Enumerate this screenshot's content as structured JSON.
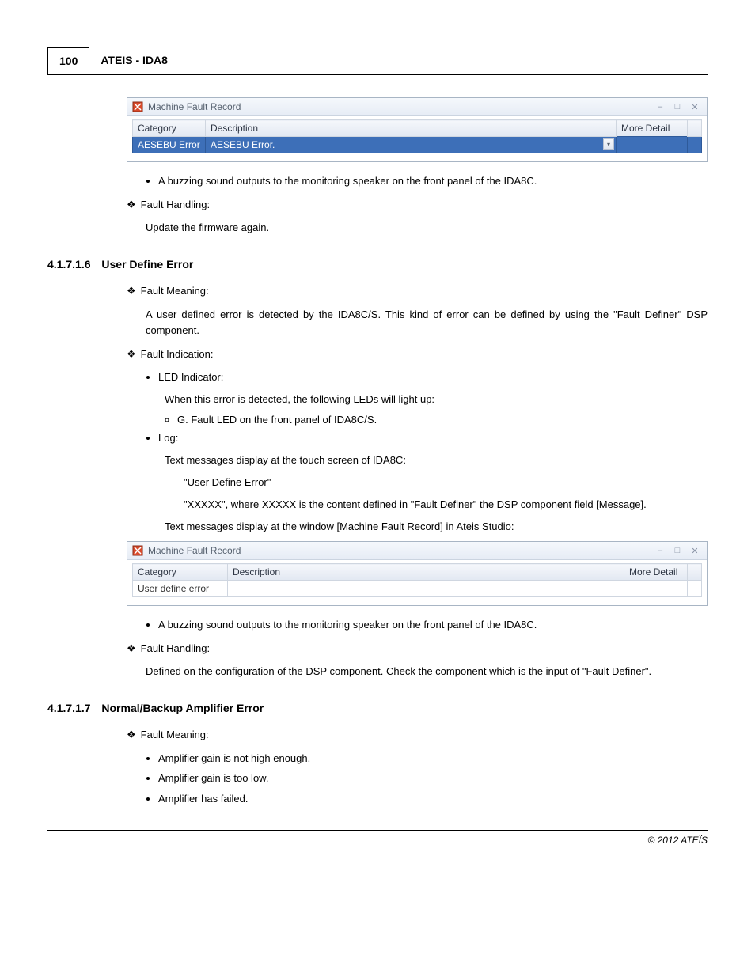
{
  "header": {
    "page_number": "100",
    "title": "ATEIS - IDA8"
  },
  "window1": {
    "title": "Machine Fault Record",
    "columns": {
      "category": "Category",
      "description": "Description",
      "more_detail": "More Detail"
    },
    "row": {
      "category": "AESEBU Error",
      "description": "AESEBU Error."
    }
  },
  "window2": {
    "title": "Machine Fault Record",
    "columns": {
      "category": "Category",
      "description": "Description",
      "more_detail": "More Detail"
    },
    "row": {
      "category": "User define error",
      "description": ""
    }
  },
  "text": {
    "buzz1": "A buzzing sound outputs to the monitoring speaker on the front panel of the IDA8C.",
    "fh": "Fault Handling:",
    "fh1_body": "Update the firmware again.",
    "sec6_num": "4.1.7.1.6",
    "sec6_title": "User Define Error",
    "fm": "Fault Meaning:",
    "fm6_body": "A user defined error is detected by the IDA8C/S. This kind of error can be defined by using the \"Fault Definer\" DSP component.",
    "fi": "Fault Indication:",
    "led": "LED Indicator:",
    "led_body": "When this error is detected, the following LEDs will light up:",
    "led_item": "G. Fault LED on the front panel of IDA8C/S.",
    "log": "Log:",
    "log_body1": "Text messages display at the touch screen of IDA8C:",
    "log_msg1": "\"User Define Error\"",
    "log_msg2": "\"XXXXX\", where XXXXX is the content defined in \"Fault Definer\" the DSP component field [Message].",
    "log_body2": "Text messages display at the window [Machine Fault Record] in Ateis Studio:",
    "buzz2": "A buzzing sound outputs to the monitoring speaker on the front panel of the IDA8C.",
    "fh6_body": "Defined on the configuration of the DSP component. Check the component which is the input of \"Fault Definer\".",
    "sec7_num": "4.1.7.1.7",
    "sec7_title": "Normal/Backup Amplifier Error",
    "fm7_b1": "Amplifier gain is not high enough.",
    "fm7_b2": "Amplifier gain is too low.",
    "fm7_b3": "Amplifier has failed."
  },
  "footer": {
    "copyright": "© 2012 ATEÏS"
  }
}
